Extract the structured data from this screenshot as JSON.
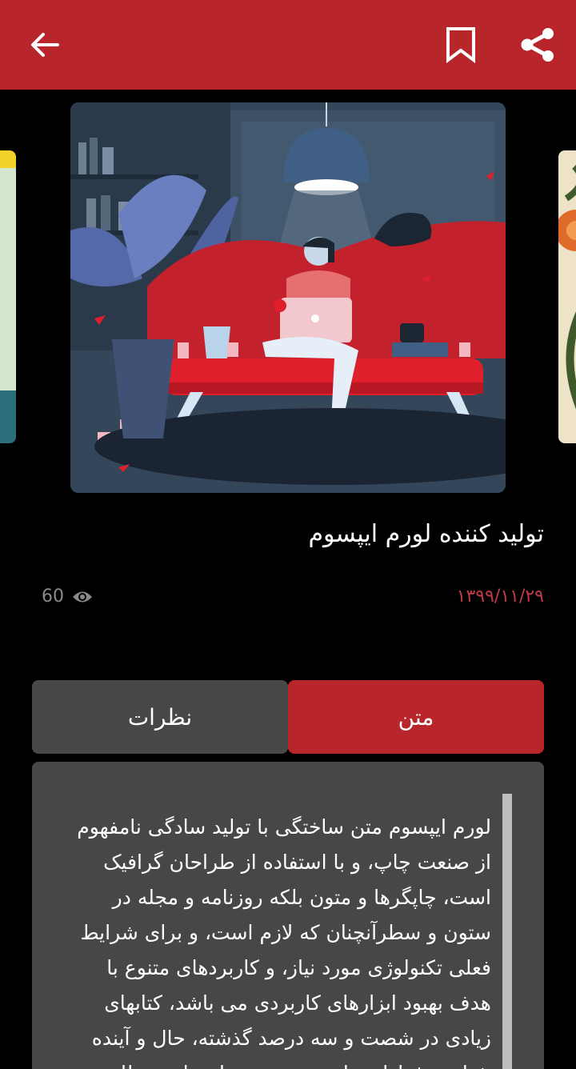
{
  "header": {
    "back_icon": "arrow-left-icon",
    "bookmark_icon": "bookmark-icon",
    "share_icon": "share-icon",
    "bar_color": "#b8252b"
  },
  "carousel": {
    "main_image": "illustration of woman with laptop on red sofa",
    "left_image": "partial illustration",
    "right_image": "partial illustration"
  },
  "article": {
    "title": "تولید کننده لورم ایپسوم",
    "date": "۱۳۹۹/۱۱/۲۹",
    "views": "60",
    "views_icon": "eye-icon"
  },
  "tabs": [
    {
      "label": "نظرات",
      "active": false
    },
    {
      "label": "متن",
      "active": true
    }
  ],
  "body_text": "لورم ایپسوم متن ساختگی با تولید سادگی نامفهوم از صنعت چاپ، و با استفاده از طراحان گرافیک است، چاپگرها و متون بلکه روزنامه و مجله در ستون و سطرآنچنان که لازم است، و برای شرایط فعلی تکنولوژی مورد نیاز، و کاربردهای متنوع با هدف بهبود ابزارهای کاربردی می باشد، کتابهای زیادی در شصت و سه درصد گذشته، حال و آینده شناخت فراوان جامعه و متخصصان را می طلبد"
}
